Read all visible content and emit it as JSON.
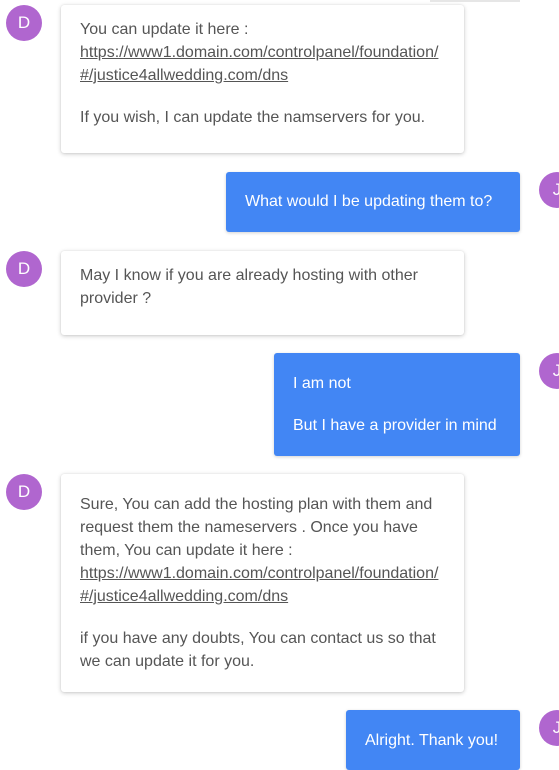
{
  "avatars": {
    "agent_initial": "D",
    "user_initial": "J"
  },
  "messages": [
    {
      "sender": "agent",
      "lines_before_link": "You can update it here :",
      "link": "https://www1.domain.com/controlpanel/foundation/#/justice4allwedding.com/dns",
      "after": "If you wish, I can update the namservers for you."
    },
    {
      "sender": "user",
      "text": "What would I be updating them to?"
    },
    {
      "sender": "agent",
      "text": "May I know if you are already hosting with other provider  ?"
    },
    {
      "sender": "user",
      "line1": "I am not",
      "line2": "But I have a provider in mind"
    },
    {
      "sender": "agent",
      "lines_before_link": "Sure, You can add the hosting plan with them and request them the nameservers . Once you have them, You can update it here :",
      "link": "https://www1.domain.com/controlpanel/foundation/#/justice4allwedding.com/dns",
      "after": "if you have any doubts, You can contact us so that we can update it for you."
    },
    {
      "sender": "user",
      "text": "Alright. Thank you!"
    }
  ],
  "colors": {
    "user_bubble": "#4286f4",
    "avatar": "#b066cf",
    "agent_text": "#555555"
  }
}
